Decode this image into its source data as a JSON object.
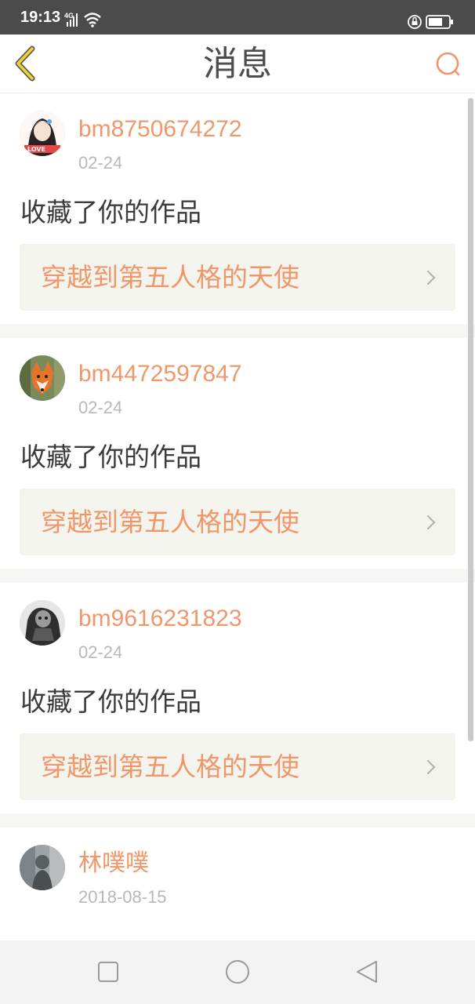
{
  "status_bar": {
    "time": "19:13",
    "network": "4G"
  },
  "header": {
    "title": "消息"
  },
  "colors": {
    "accent": "#f0976a",
    "status_bar": "#4b4b4b",
    "card_link_bg": "#f4f4ee",
    "date_text": "#b8b8b8"
  },
  "messages": [
    {
      "username": "bm8750674272",
      "date": "02-24",
      "action": "收藏了你的作品",
      "work_title": "穿越到第五人格的天使",
      "avatar_icon": "anime-girl-avatar"
    },
    {
      "username": "bm4472597847",
      "date": "02-24",
      "action": "收藏了你的作品",
      "work_title": "穿越到第五人格的天使",
      "avatar_icon": "fox-avatar"
    },
    {
      "username": "bm9616231823",
      "date": "02-24",
      "action": "收藏了你的作品",
      "work_title": "穿越到第五人格的天使",
      "avatar_icon": "dark-figure-avatar"
    },
    {
      "username": "林噗噗",
      "date": "2018-08-15",
      "action": "",
      "avatar_icon": "photo-avatar"
    }
  ],
  "nav_bar": {
    "buttons": [
      "recents-icon",
      "home-icon",
      "back-triangle-icon"
    ]
  }
}
